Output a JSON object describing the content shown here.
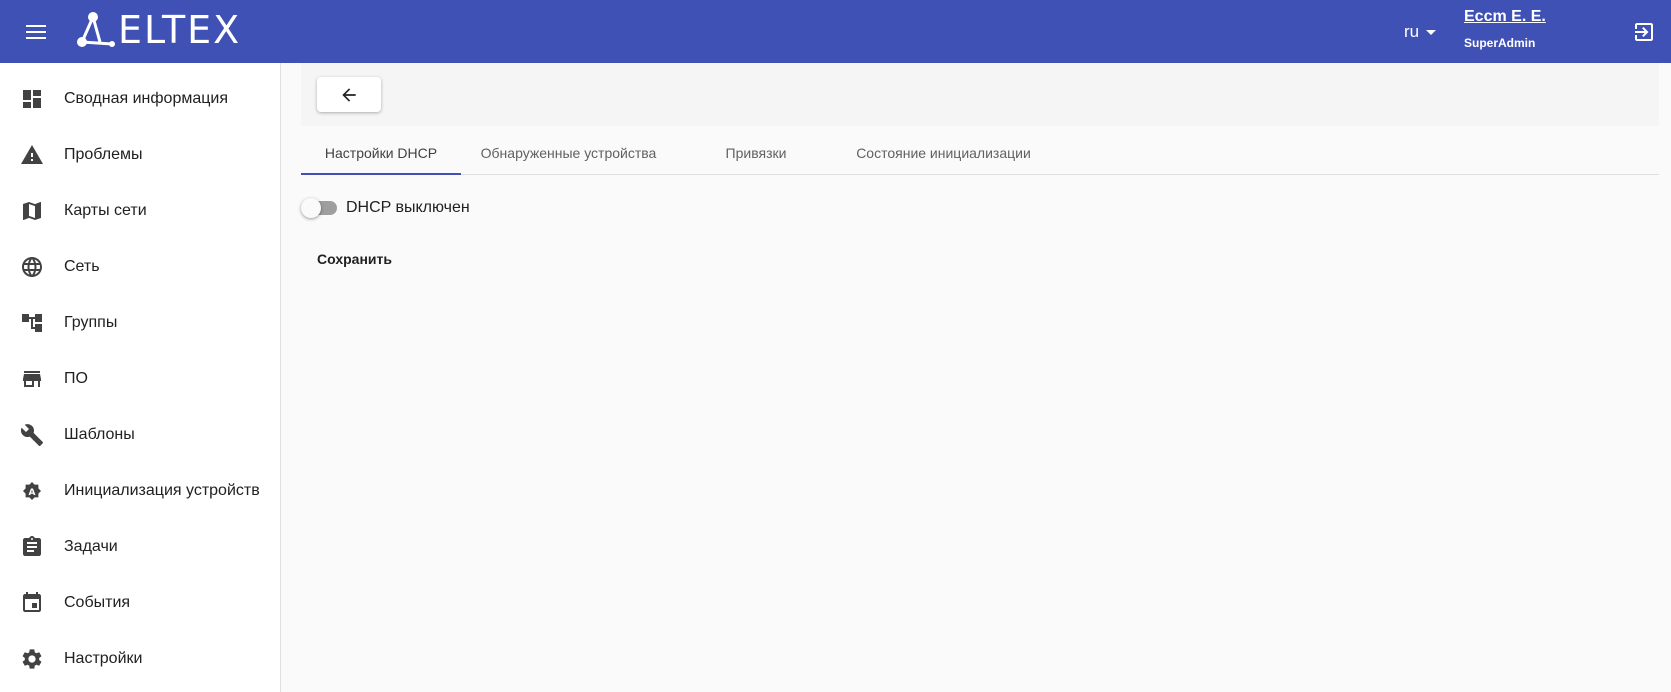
{
  "header": {
    "logo_text": "ELTEX",
    "language": "ru",
    "user_name": "Eccm E. E.",
    "user_role": "SuperAdmin",
    "bar_color": "#3f51b5"
  },
  "sidebar": {
    "items": [
      {
        "label": "Сводная информация",
        "icon": "dashboard-icon"
      },
      {
        "label": "Проблемы",
        "icon": "warning-icon"
      },
      {
        "label": "Карты сети",
        "icon": "map-icon"
      },
      {
        "label": "Сеть",
        "icon": "globe-icon"
      },
      {
        "label": "Группы",
        "icon": "tree-icon"
      },
      {
        "label": "ПО",
        "icon": "store-icon"
      },
      {
        "label": "Шаблоны",
        "icon": "wrench-icon"
      },
      {
        "label": "Инициализация устройств",
        "icon": "auto-badge-icon"
      },
      {
        "label": "Задачи",
        "icon": "clipboard-icon"
      },
      {
        "label": "События",
        "icon": "calendar-icon"
      },
      {
        "label": "Настройки",
        "icon": "gear-icon"
      }
    ]
  },
  "tabs": [
    {
      "label": "Настройки DHCP",
      "active": true
    },
    {
      "label": "Обнаруженные устройства",
      "active": false
    },
    {
      "label": "Привязки",
      "active": false
    },
    {
      "label": "Состояние инициализации",
      "active": false
    }
  ],
  "dhcp": {
    "toggle_label": "DHCP выключен",
    "enabled": false
  },
  "actions": {
    "save_label": "Сохранить"
  }
}
